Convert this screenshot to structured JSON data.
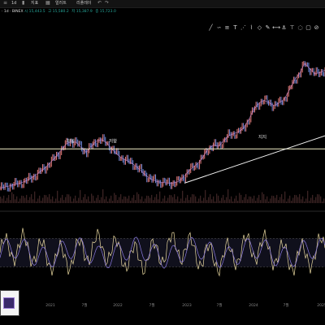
{
  "toolbar": {
    "items": [
      "1d",
      "지표",
      "얼러트",
      "리플레이"
    ],
    "symbol": "· 1d · BINEX",
    "ohlc": [
      "시 15,443.5",
      "고 15,580.2",
      "저 15,387.9",
      "종 15,723.0"
    ]
  },
  "drawing_tools": [
    "pen-icon",
    "brush-icon",
    "ruler-icon",
    "text-icon",
    "pattern-icon",
    "path-icon",
    "shape-icon",
    "note-icon",
    "measure-icon",
    "anchor-icon",
    "pin-icon",
    "hide-icon",
    "lock-icon",
    "trash-icon"
  ],
  "annotations": {
    "resistance_1": "저항",
    "resistance_2": "저항",
    "support": "지지"
  },
  "chart_data": {
    "type": "line",
    "title": "",
    "x_tick_labels": [
      "2021",
      "7월",
      "2022",
      "7월",
      "2023",
      "7월",
      "2024",
      "7월",
      "2025"
    ],
    "price_series": [
      220,
      222,
      224,
      226,
      228,
      231,
      235,
      240,
      246,
      252,
      260,
      268,
      278,
      287,
      292,
      290,
      282,
      275,
      284,
      292,
      294,
      289,
      280,
      272,
      266,
      262,
      258,
      252,
      245,
      238,
      233,
      230,
      229,
      228,
      228,
      230,
      236,
      245,
      252,
      258,
      268,
      280,
      286,
      284,
      292,
      300,
      303,
      306,
      312,
      325,
      340,
      350,
      354,
      350,
      346,
      350,
      356,
      370,
      385,
      395,
      410,
      402,
      394,
      396,
      400
    ],
    "resistance_level": 280,
    "trendline": {
      "from": 228,
      "to": 300
    },
    "oscillator": {
      "upper_band": 70,
      "lower_band": 30,
      "range": [
        0,
        100
      ]
    }
  }
}
